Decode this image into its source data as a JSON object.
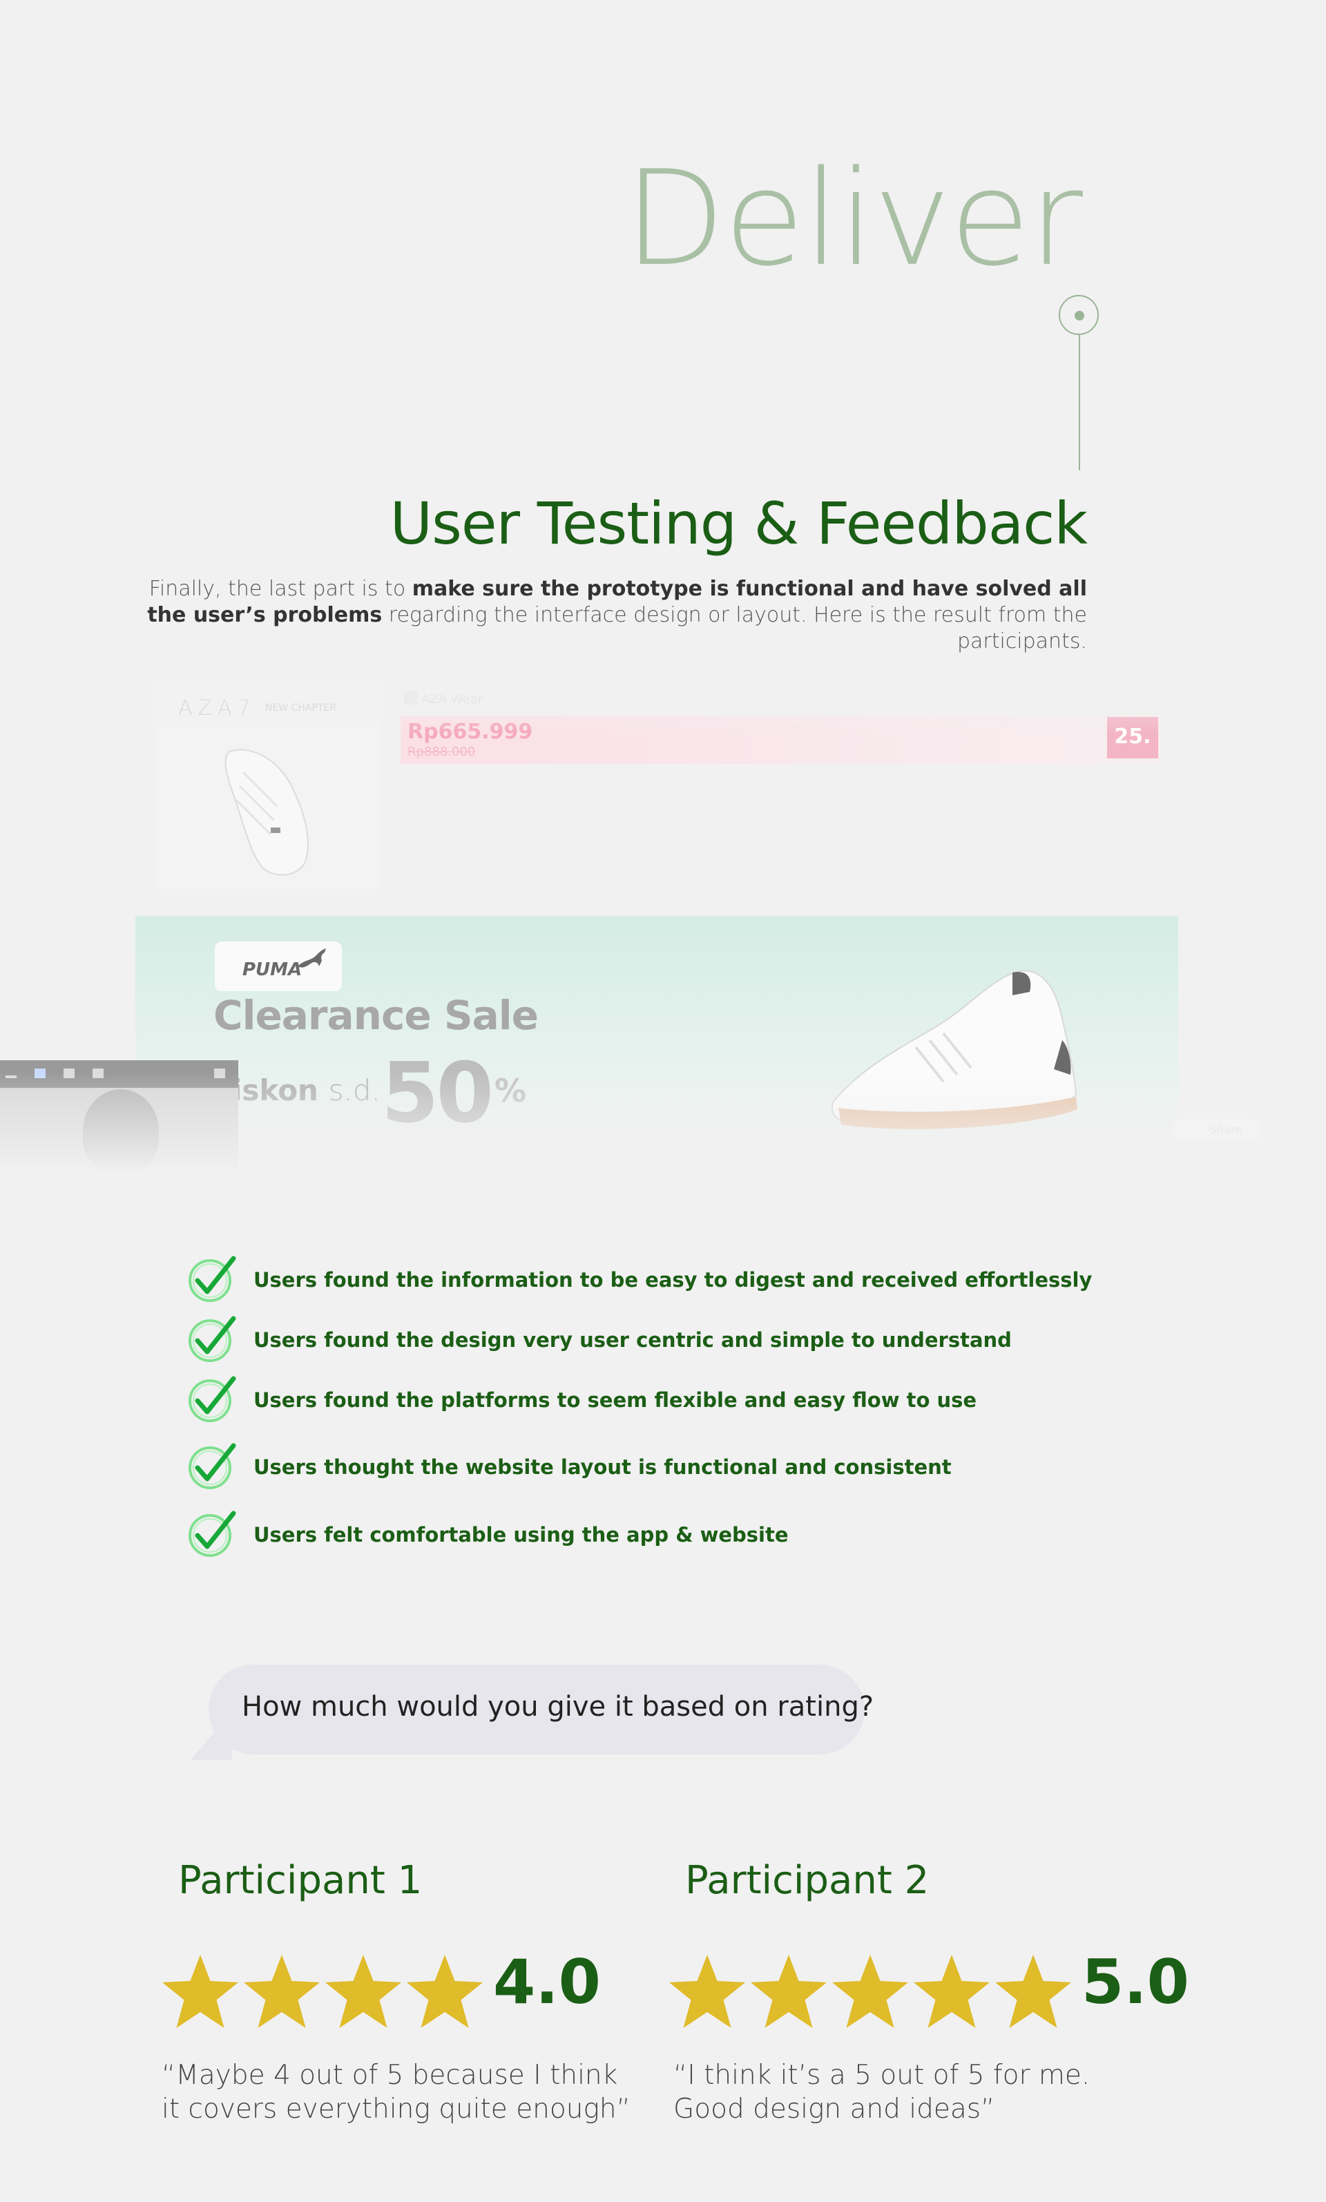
{
  "header": {
    "title": "Deliver",
    "section_title": "User Testing & Feedback",
    "intro": {
      "part1": "Finally, the last part is to ",
      "bold1": "make sure the prototype is functional and have solved all the user’s problems",
      "part2": " regarding the interface design or layout. Here is the result from the participants."
    }
  },
  "mockup": {
    "product": {
      "brand": "AZA7",
      "brand_tag": "NEW CHAPTER",
      "store": "AZA Wear",
      "price": "Rp665.999",
      "old_price": "Rp888.000",
      "discount": "25."
    },
    "banner": {
      "brand": "PUMA",
      "title": "Clearance Sale",
      "discount_prefix": "iskon",
      "discount_sd": "s.d.",
      "discount_value": "50",
      "discount_unit": "%"
    },
    "share_label": "Share"
  },
  "checklist": [
    "Users found the information to be easy to digest and received effortlessly",
    "Users found the design very user centric and simple to understand",
    "Users found the platforms to seem flexible and easy flow to use",
    "Users thought the website layout is functional and consistent",
    "Users felt comfortable using the app & website"
  ],
  "question": "How much would you give it based on rating?",
  "participants": [
    {
      "label": "Participant 1",
      "rating": 4,
      "score": "4.0",
      "quote_line1": "“Maybe 4 out of 5 because I think",
      "quote_line2": "it covers everything quite enough”"
    },
    {
      "label": "Participant 2",
      "rating": 5,
      "score": "5.0",
      "quote_line1": "“I think it’s a 5 out of 5 for me.",
      "quote_line2": "Good design and ideas”"
    }
  ],
  "colors": {
    "accent_green": "#1b5e15",
    "muted_green": "#a9c0a5",
    "star": "#e0bb2a",
    "check": "#2cc84a"
  }
}
